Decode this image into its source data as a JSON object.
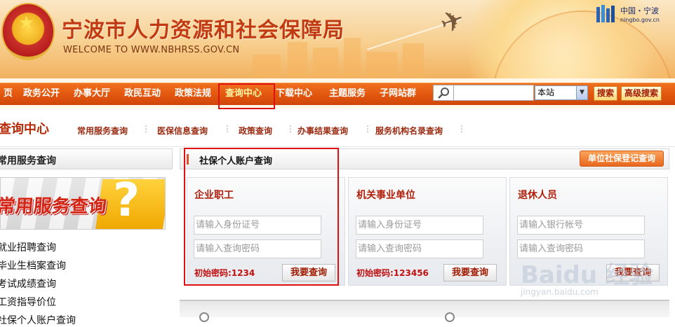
{
  "header": {
    "title": "宁波市人力资源和社会保障局",
    "subtitle": "WELCOME TO WWW.NBHRSS.GOV.CN",
    "partner_name": "中国・宁波",
    "partner_url": "ningbo.gov.cn"
  },
  "nav": {
    "items": [
      "页",
      "政务公开",
      "办事大厅",
      "政民互动",
      "政策法规",
      "查询中心",
      "下载中心",
      "主题服务",
      "子网站群"
    ],
    "active_index": 5,
    "search_placeholder": "",
    "scope_value": "本站",
    "search_button": "搜索",
    "advanced_button": "高级搜索"
  },
  "subnav": {
    "title": "查询中心",
    "links": [
      "常用服务查询",
      "医保信息查询",
      "政策查询",
      "办事结果查询",
      "服务机构名录查询"
    ]
  },
  "left": {
    "heading": "常用服务查询",
    "promo_text": "常用服务查询",
    "links": [
      "就业招聘查询",
      "毕业生档案查询",
      "考试成绩查询",
      "工资指导价位",
      "社保个人账户查询"
    ]
  },
  "main": {
    "heading": "社保个人账户查询",
    "unit_button": "单位社保登记查询",
    "cards": [
      {
        "title": "企业职工",
        "field1": "请输入身份证号",
        "field2": "请输入查询密码",
        "hint": "初始密码:1234",
        "button": "我要查询"
      },
      {
        "title": "机关事业单位",
        "field1": "请输入身份证号",
        "field2": "请输入查询密码",
        "hint": "初始密码:123456",
        "button": "我要查询"
      },
      {
        "title": "退休人员",
        "field1": "请输入银行帐号",
        "field2": "请输入查询密码",
        "hint": "",
        "button": "我要查询"
      }
    ]
  },
  "watermark": {
    "text": "Baidu 经验",
    "url": "jingyan.baidu.com"
  },
  "colors": {
    "nav_bg": "#e2560e",
    "accent_red": "#c01010",
    "title_red": "#c23a12",
    "highlight_box": "#e01010"
  }
}
